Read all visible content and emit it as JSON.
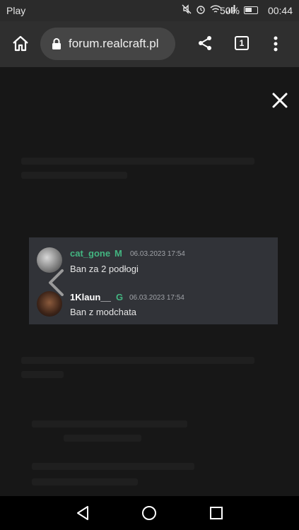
{
  "status_bar": {
    "carrier": "Play",
    "battery_percent": "50%",
    "time": "00:44",
    "icons": [
      "mute-icon",
      "alarm-icon",
      "wifi-icon",
      "signal-icon",
      "battery-icon"
    ]
  },
  "browser": {
    "url": "forum.realcraft.pl",
    "tab_count": "1"
  },
  "lightbox": {
    "messages": [
      {
        "username": "cat_gone",
        "badge": "M",
        "username_color": "#43b581",
        "timestamp": "06.03.2023 17:54",
        "text": "Ban za 2 podłogi"
      },
      {
        "username": "1Klaun__",
        "badge": "G",
        "username_color": "#ffffff",
        "timestamp": "06.03.2023 17:54",
        "text": "Ban z modchata"
      }
    ]
  }
}
